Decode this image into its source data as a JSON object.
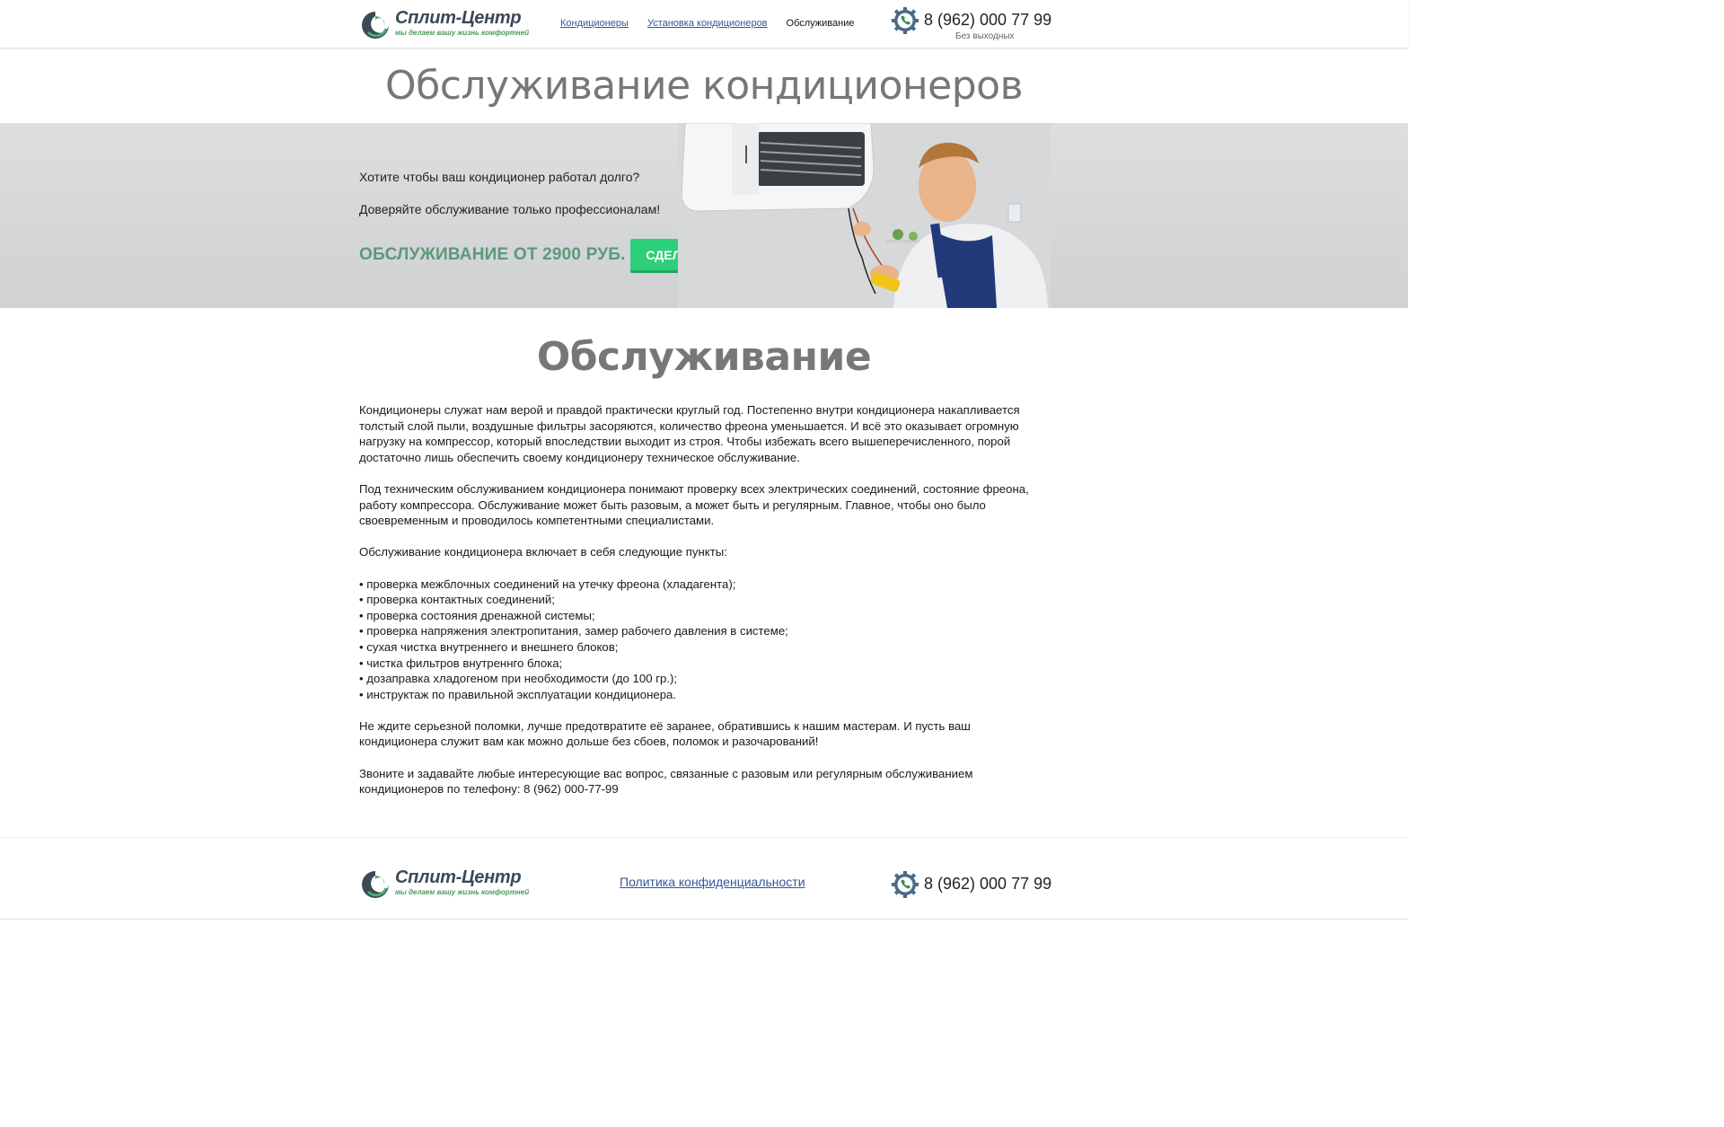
{
  "header": {
    "logo": {
      "name": "Сплит-Центр",
      "tagline": "мы делаем вашу жизнь комфортней"
    },
    "nav": [
      {
        "label": "Кондиционеры"
      },
      {
        "label": "Установка кондиционеров"
      }
    ],
    "nav_current": "Обслуживание",
    "phone": {
      "number": "8 (962) 000 77 99",
      "note": "Без выходных"
    }
  },
  "page_title": "Обслуживание кондиционеров",
  "hero": {
    "question": "Хотите чтобы ваш кондиционер работал долго?",
    "trust": "Доверяйте обслуживание только профессионалам!",
    "price": "ОБСЛУЖИВАНИЕ ОТ 2900 РУБ.",
    "button": "СДЕЛАТЬ ЗАКАЗ"
  },
  "section_title": "Обслуживание",
  "content": {
    "p1": "Кондиционеры служат нам верой и правдой практически круглый год. Постепенно внутри кондиционера накапливается толстый слой пыли, воздушные фильтры засоряются, количество фреона уменьшается. И всё это оказывает огромную нагрузку на компрессор, который впоследствии выходит из строя. Чтобы избежать всего вышеперечисленного, порой достаточно лишь обеспечить своему кондиционеру техническое обслуживание.",
    "p2": "Под техническим обслуживанием кондиционера понимают проверку всех электрических соединений, состояние фреона, работу компрессора. Обслуживание может быть разовым, а может быть и регулярным. Главное, чтобы оно было своевременным и проводилось компетентными специалистами.",
    "p3": "Обслуживание кондиционера включает в себя следующие пункты:",
    "items": [
      "проверка межблочных соединений на утечку фреона (хладагента);",
      "проверка контактных соединений;",
      "проверка состояния дренажной системы;",
      "проверка напряжения электропитания, замер рабочего давления в системе;",
      "сухая чистка внутреннего и внешнего блоков;",
      "чистка фильтров внутреннго блока;",
      "дозаправка хладогеном при необходимости (до 100 гр.);",
      "инструктаж по правильной эксплуатации кондиционера."
    ],
    "p4": "Не ждите серьезной поломки, лучше предотвратите её заранее, обратившись к нашим мастерам. И пусть ваш кондиционера служит вам как можно дольше без сбоев, поломок и разочарований!",
    "p5": "Звоните и задавайте любые интересующие вас вопрос, связанные с разовым или регулярным обслуживанием кондиционеров по телефону: 8 (962) 000-77-99"
  },
  "footer": {
    "logo": {
      "name": "Сплит-Центр",
      "tagline": "мы делаем вашу жизнь комфортней"
    },
    "privacy_link": "Политика конфиденциальности",
    "phone": "8 (962) 000 77 99"
  },
  "colors": {
    "accent_green": "#2ecf7a",
    "price_green": "#5a9a7a",
    "link_blue": "#34559b",
    "title_gray": "#777777"
  },
  "icons": [
    "logo-swirl-icon",
    "phone-gear-icon"
  ]
}
